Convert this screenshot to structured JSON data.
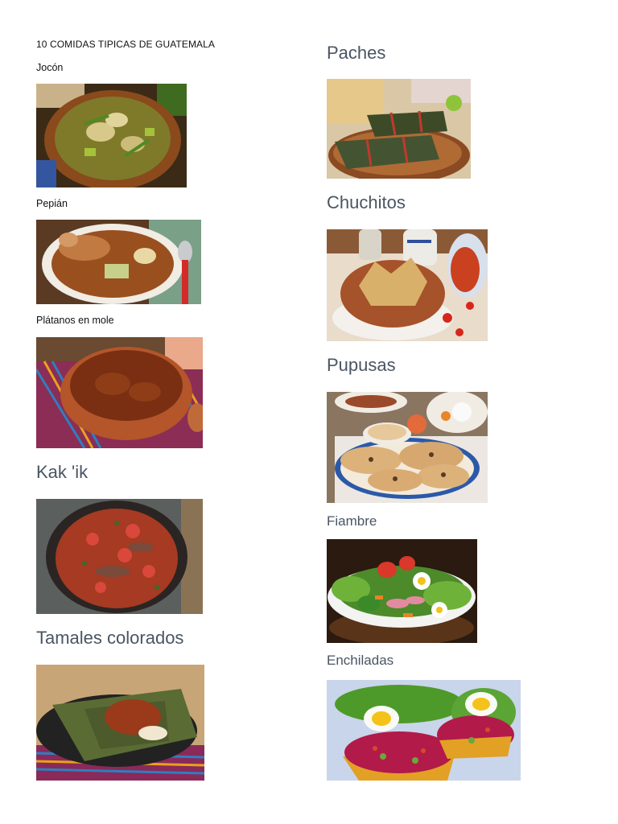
{
  "document": {
    "title": "10 COMIDAS TIPICAS DE GUATEMALA"
  },
  "dishes": [
    {
      "name": "Jocón",
      "image_desc": "jocon-stew-photo"
    },
    {
      "name": "Pepián",
      "image_desc": "pepian-stew-photo"
    },
    {
      "name": "Plátanos en mole",
      "image_desc": "platanos-en-mole-photo"
    },
    {
      "name": "Kak 'ik",
      "image_desc": "kakik-soup-photo"
    },
    {
      "name": "Tamales colorados",
      "image_desc": "tamales-colorados-photo"
    },
    {
      "name": "Paches",
      "image_desc": "paches-photo"
    },
    {
      "name": "Chuchitos",
      "image_desc": "chuchitos-photo"
    },
    {
      "name": "Pupusas",
      "image_desc": "pupusas-photo"
    },
    {
      "name": "Fiambre",
      "image_desc": "fiambre-photo"
    },
    {
      "name": "Enchiladas",
      "image_desc": "enchiladas-photo"
    }
  ],
  "colors": {
    "heading": "#4a5563",
    "text": "#111111"
  }
}
